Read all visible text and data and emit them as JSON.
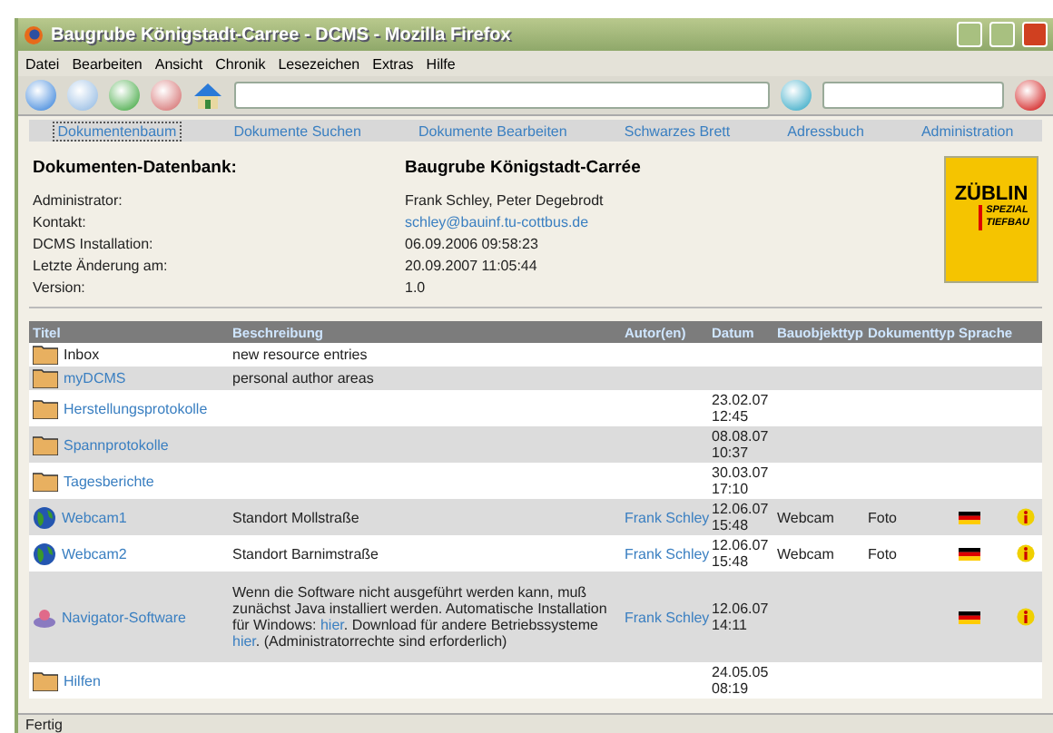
{
  "window": {
    "title": "Baugrube Königstadt-Carree - DCMS - Mozilla Firefox"
  },
  "menu": [
    "Datei",
    "Bearbeiten",
    "Ansicht",
    "Chronik",
    "Lesezeichen",
    "Extras",
    "Hilfe"
  ],
  "nav_tabs": [
    {
      "label": "Dokumentenbaum",
      "selected": true
    },
    {
      "label": "Dokumente Suchen",
      "selected": false
    },
    {
      "label": "Dokumente Bearbeiten",
      "selected": false
    },
    {
      "label": "Schwarzes Brett",
      "selected": false
    },
    {
      "label": "Adressbuch",
      "selected": false
    },
    {
      "label": "Administration",
      "selected": false
    }
  ],
  "heading": "Dokumenten-Datenbank:",
  "project": "Baugrube Königstadt-Carrée",
  "info": [
    {
      "label": "Administrator:",
      "value": "Frank Schley, Peter Degebrodt",
      "kind": "text"
    },
    {
      "label": "Kontakt:",
      "value": "schley@bauinf.tu-cottbus.de",
      "kind": "link"
    },
    {
      "label": "DCMS Installation:",
      "value": "06.09.2006 09:58:23",
      "kind": "text"
    },
    {
      "label": "Letzte Änderung am:",
      "value": "20.09.2007 11:05:44",
      "kind": "text"
    },
    {
      "label": "Version:",
      "value": "1.0",
      "kind": "text"
    }
  ],
  "logo": {
    "name": "ZÜBLIN",
    "line1": "SPEZIAL",
    "line2": "TIEFBAU"
  },
  "table": {
    "columns": [
      "Titel",
      "Beschreibung",
      "Autor(en)",
      "Datum",
      "Bauobjekttyp",
      "Dokumenttyp",
      "Sprache"
    ],
    "rows": [
      {
        "kind": "folder",
        "title": "Inbox",
        "link": false,
        "description": [
          {
            "text": "new resource entries",
            "link": false
          }
        ],
        "author": "",
        "date": "",
        "bauobjekt": "",
        "doktyp": "",
        "flag": false,
        "info": false
      },
      {
        "kind": "folder",
        "title": "myDCMS",
        "link": true,
        "description": [
          {
            "text": "personal author areas",
            "link": false
          }
        ],
        "author": "",
        "date": "",
        "bauobjekt": "",
        "doktyp": "",
        "flag": false,
        "info": false
      },
      {
        "kind": "folder",
        "title": "Herstellungsprotokolle",
        "link": true,
        "description": [],
        "author": "",
        "date": "23.02.07 12:45",
        "bauobjekt": "",
        "doktyp": "",
        "flag": false,
        "info": false
      },
      {
        "kind": "folder",
        "title": "Spannprotokolle",
        "link": true,
        "description": [],
        "author": "",
        "date": "08.08.07 10:37",
        "bauobjekt": "",
        "doktyp": "",
        "flag": false,
        "info": false
      },
      {
        "kind": "folder",
        "title": "Tagesberichte",
        "link": true,
        "description": [],
        "author": "",
        "date": "30.03.07 17:10",
        "bauobjekt": "",
        "doktyp": "",
        "flag": false,
        "info": false
      },
      {
        "kind": "globe",
        "title": "Webcam1",
        "link": true,
        "description": [
          {
            "text": "Standort Mollstraße",
            "link": false
          }
        ],
        "author": "Frank Schley",
        "date": "12.06.07 15:48",
        "bauobjekt": "Webcam",
        "doktyp": "Foto",
        "flag": true,
        "info": true
      },
      {
        "kind": "globe",
        "title": "Webcam2",
        "link": true,
        "description": [
          {
            "text": "Standort Barnimstraße",
            "link": false
          }
        ],
        "author": "Frank Schley",
        "date": "12.06.07 15:48",
        "bauobjekt": "Webcam",
        "doktyp": "Foto",
        "flag": true,
        "info": true
      },
      {
        "kind": "software",
        "title": "Navigator-Software",
        "link": true,
        "description": [
          {
            "text": "Wenn die Software nicht ausgeführt werden kann, muß zunächst Java installiert werden. Automatische Installation für Windows: ",
            "link": false
          },
          {
            "text": "hier",
            "link": true
          },
          {
            "text": ". Download für andere Betriebssysteme ",
            "link": false
          },
          {
            "text": "hier",
            "link": true
          },
          {
            "text": ". (Administratorrechte sind erforderlich)",
            "link": false
          }
        ],
        "author": "Frank Schley",
        "date": "12.06.07 14:11",
        "bauobjekt": "",
        "doktyp": "",
        "flag": true,
        "info": true
      },
      {
        "kind": "folder",
        "title": "Hilfen",
        "link": true,
        "description": [],
        "author": "",
        "date": "24.05.05 08:19",
        "bauobjekt": "",
        "doktyp": "",
        "flag": false,
        "info": false
      }
    ]
  },
  "status_bar": "Fertig"
}
